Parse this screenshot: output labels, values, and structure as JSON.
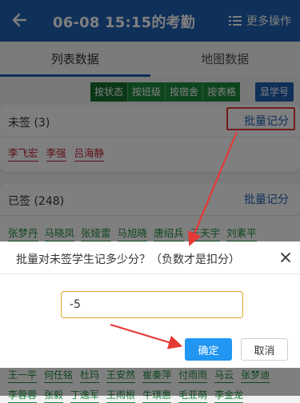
{
  "header": {
    "title": "06-08 15:15的考勤",
    "more_label": "更多操作",
    "back_icon": "arrow-left-icon",
    "more_icon": "list-menu-icon",
    "bg_color": "#1f60b3"
  },
  "tabs": [
    {
      "label": "列表数据",
      "active": true
    },
    {
      "label": "地图数据",
      "active": false
    }
  ],
  "filter_buttons": [
    {
      "label": "按状态",
      "active": true
    },
    {
      "label": "按班级",
      "active": false
    },
    {
      "label": "按宿舍",
      "active": false
    },
    {
      "label": "按表格",
      "active": false
    }
  ],
  "show_student_id_label": "显学号",
  "unsigned": {
    "header": "未签 (3)",
    "batch_label": "批量记分",
    "names": [
      "李飞宏",
      "李强",
      "吕海静"
    ]
  },
  "signed": {
    "header": "已签 (248)",
    "batch_label": "批量记分",
    "names": [
      "张梦丹",
      "马晓凤",
      "张娅雷",
      "马旭晓",
      "唐绍兵",
      "王天宇",
      "刘素平"
    ]
  },
  "dialog": {
    "title": "批量对未签学生记多少分？（负数才是扣分）",
    "input_value": "-5",
    "confirm_label": "确定",
    "cancel_label": "取消",
    "close_icon": "close-icon"
  },
  "bottom_names_row1": [
    "王一平",
    "何任铭",
    "杜玛",
    "王安然",
    "崔秦萍",
    "付雨雨",
    "马云",
    "张梦迪"
  ],
  "bottom_names_row2": [
    "李蓉蓉",
    "张毅",
    "丁逸军",
    "王雨根",
    "牛琪惠",
    "毛亚萌",
    "李金龙"
  ],
  "colors": {
    "accent_blue": "#1f60b3",
    "green": "#1e8a3d",
    "red_name": "#c0203a",
    "annotation_red": "#e53935",
    "confirm_blue": "#2196f3"
  }
}
